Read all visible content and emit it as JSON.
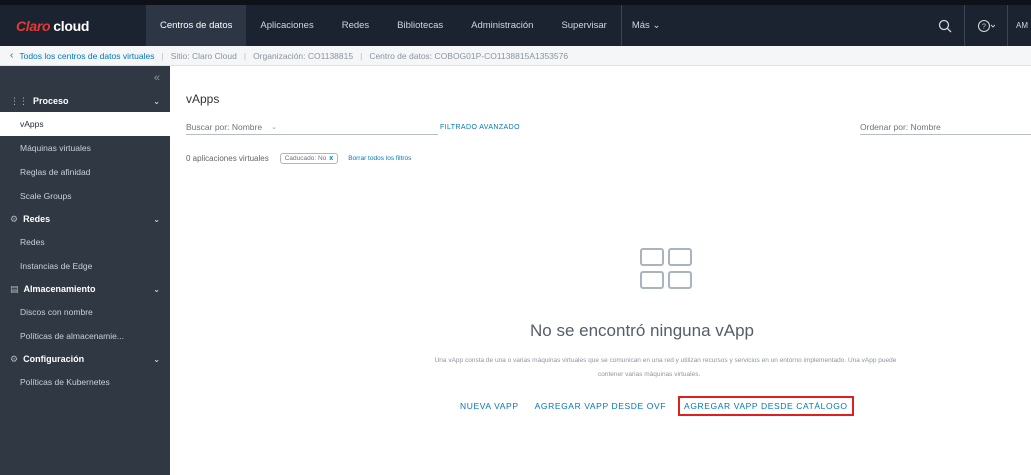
{
  "app": {
    "logo_brand": "Claro",
    "logo_product": "cloud",
    "colors": {
      "topbar": "#1c2330",
      "sidebar": "#303843",
      "link": "#0079b8",
      "brand_red": "#e53935",
      "highlight_box": "#e0201e"
    }
  },
  "nav": {
    "tabs": [
      "Centros de datos",
      "Aplicaciones",
      "Redes",
      "Bibliotecas",
      "Administración",
      "Supervisar"
    ],
    "active_tab": "Centros de datos",
    "more_label": "Más ⌄",
    "search_icon": "search-icon",
    "help_icon": "help-icon",
    "user_initials": "AM"
  },
  "breadcrumb": {
    "back_link": "Todos los centros de datos virtuales",
    "site": "Sitio: Claro Cloud",
    "org": "Organización: CO1138815",
    "datacenter": "Centro de datos: COBOG01P-CO1138815A1353576"
  },
  "sidebar": {
    "collapse_icon": "«",
    "groups": [
      {
        "label": "Proceso",
        "icon": "⋮⋮",
        "items": [
          "vApps",
          "Máquinas virtuales",
          "Reglas de afinidad",
          "Scale Groups"
        ]
      },
      {
        "label": "Redes",
        "icon": "⚙",
        "items": [
          "Redes",
          "Instancias de Edge"
        ]
      },
      {
        "label": "Almacenamiento",
        "icon": "▤",
        "items": [
          "Discos con nombre",
          "Políticas de almacenamie..."
        ]
      },
      {
        "label": "Configuración",
        "icon": "⚙",
        "items": [
          "Políticas de Kubernetes"
        ]
      }
    ],
    "active_item": "vApps"
  },
  "main": {
    "title": "vApps",
    "search_by": "Buscar por: Nombre",
    "advanced_filter": "FILTRADO AVANZADO",
    "sort_by": "Ordenar por: Nombre",
    "count_text": "0 aplicaciones virtuales",
    "chip_label": "Caducado: No",
    "chip_close": "x",
    "clear_filters": "Borrar todos los filtros",
    "empty_title": "No se encontró ninguna vApp",
    "empty_desc": "Una vApp consta de una o varias máquinas virtuales que se comunican en una red y utilizan recursos y servicios en un entorno implementado. Una vApp puede",
    "empty_desc2": "contener varias máquinas virtuales.",
    "actions": [
      "NUEVA VAPP",
      "AGREGAR VAPP DESDE OVF",
      "AGREGAR VAPP DESDE CATÁLOGO"
    ]
  }
}
